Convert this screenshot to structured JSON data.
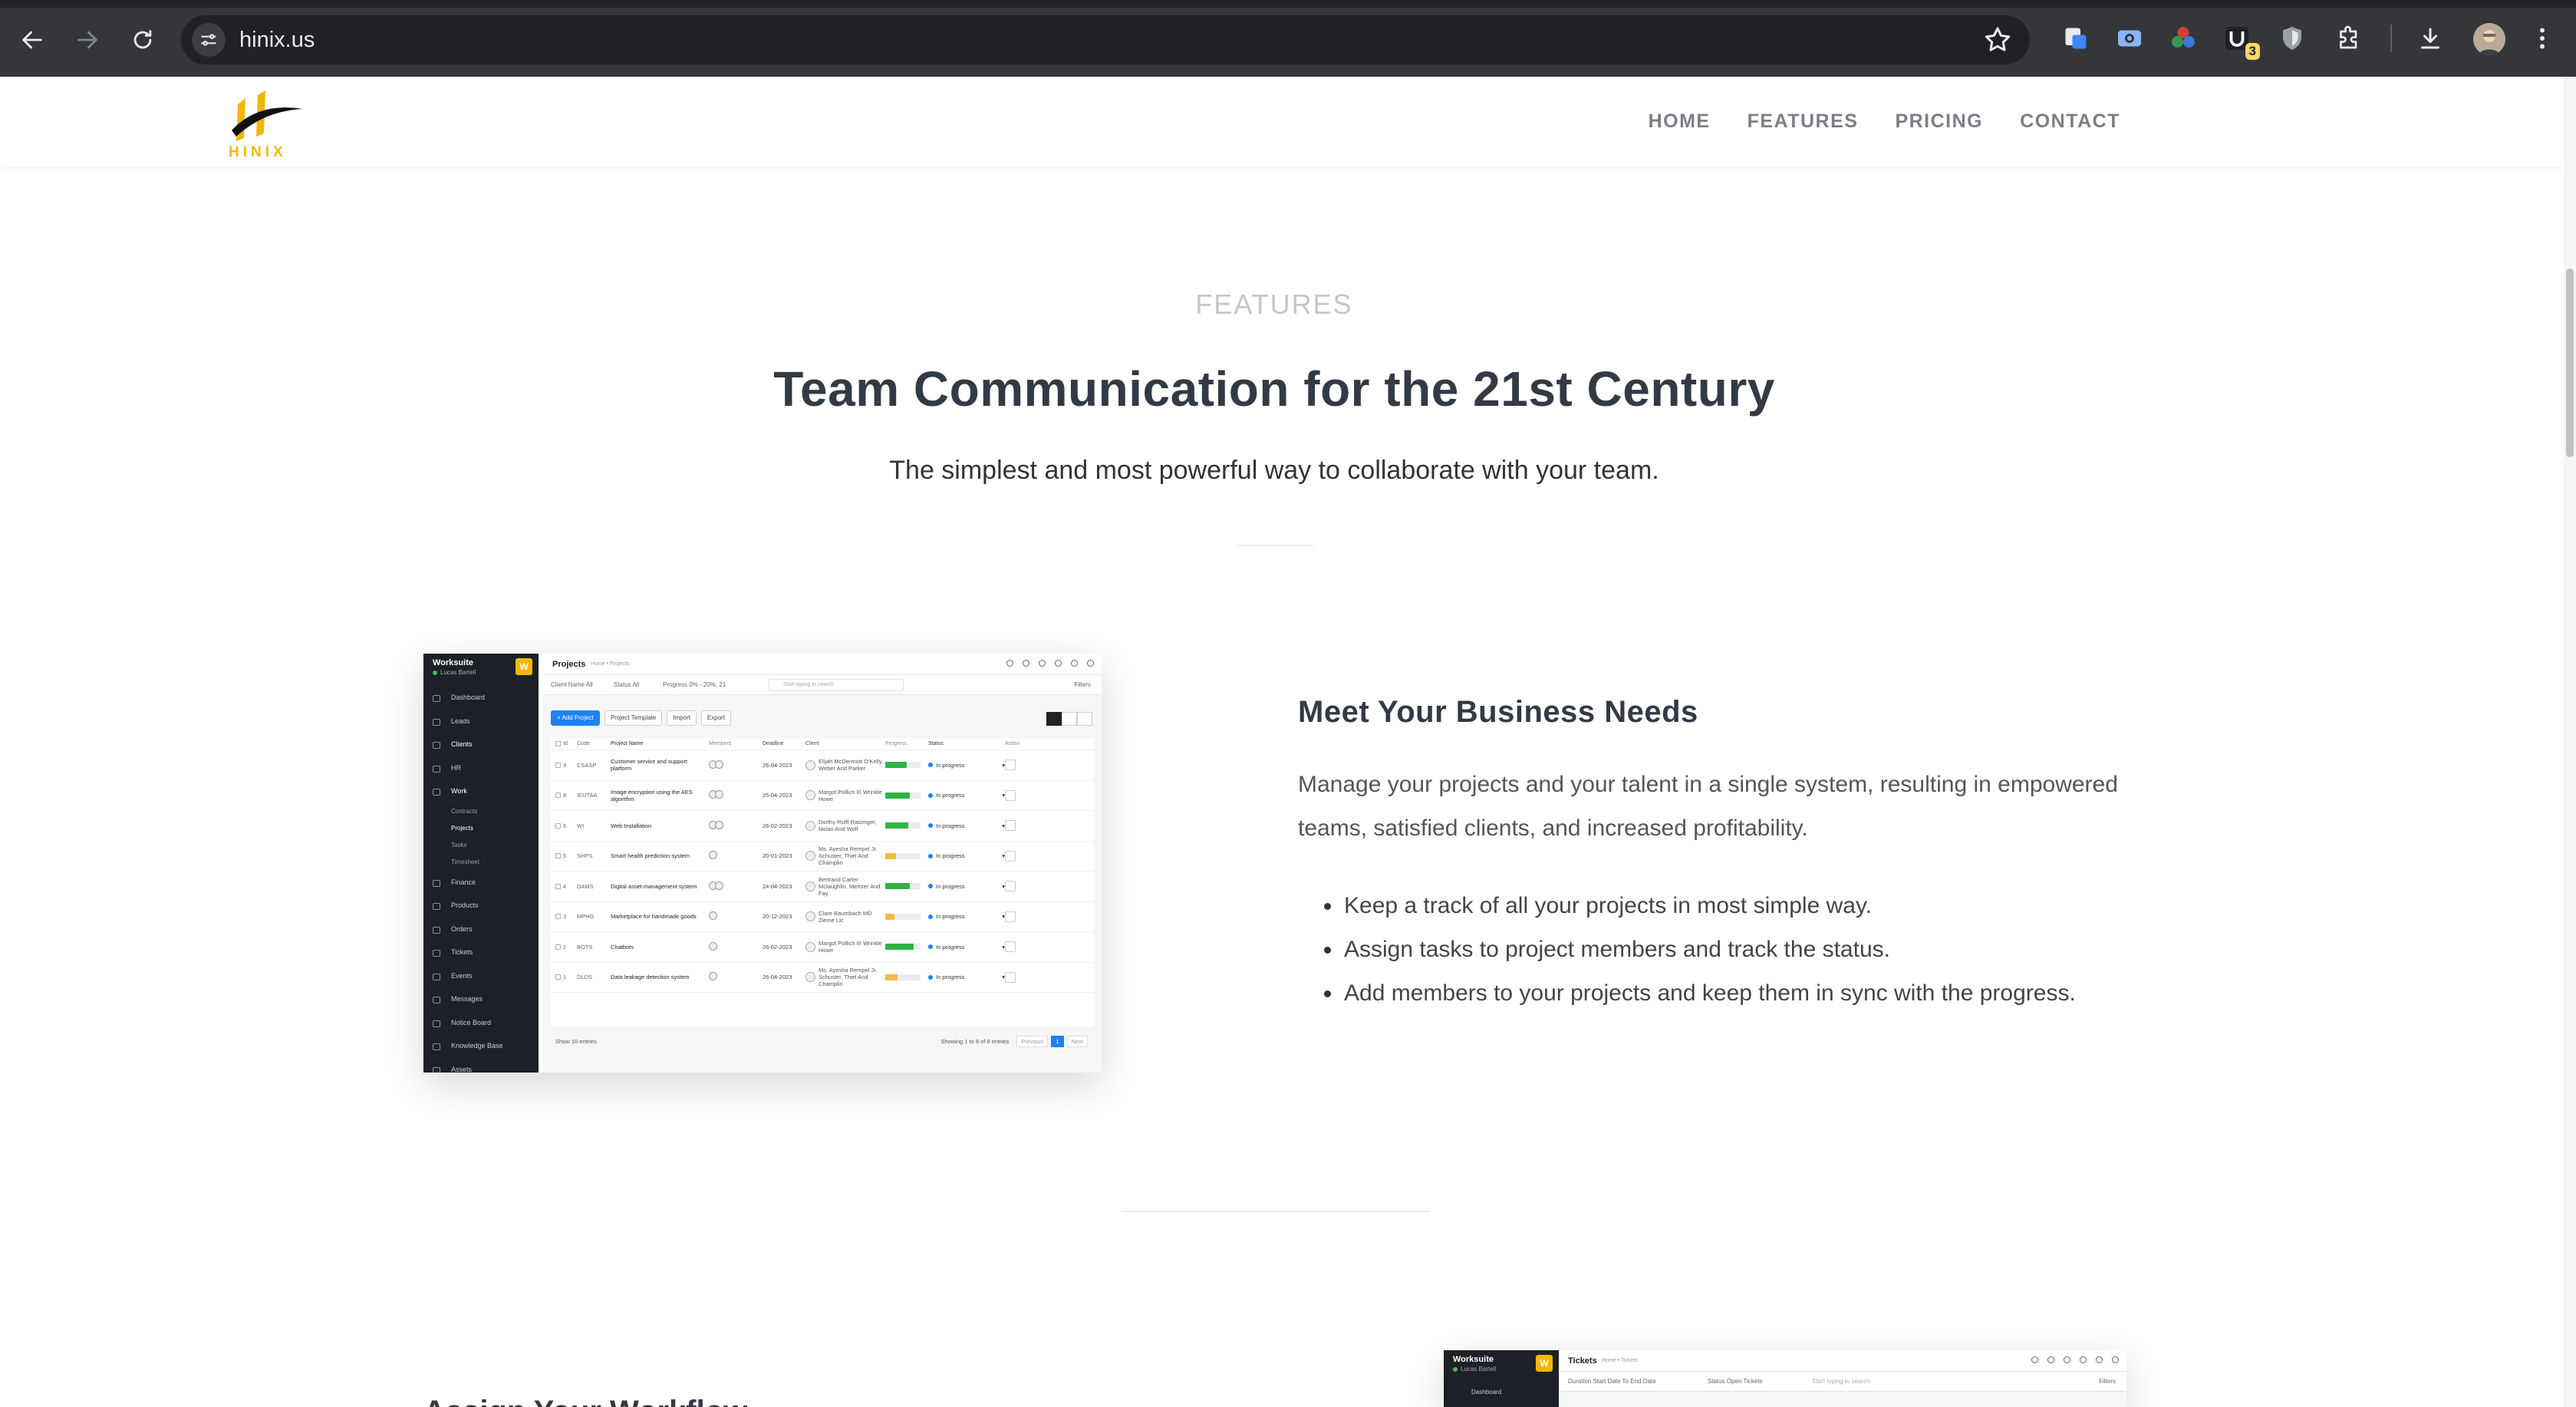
{
  "browser": {
    "url": "hinix.us",
    "extension_badge": "3"
  },
  "site": {
    "logo_text": "HINIX",
    "nav": [
      "HOME",
      "FEATURES",
      "PRICING",
      "CONTACT"
    ]
  },
  "features_section": {
    "label": "FEATURES",
    "title": "Team Communication for the 21st Century",
    "subtitle": "The simplest and most powerful way to collaborate with your team."
  },
  "feature1": {
    "title": "Meet Your Business Needs",
    "description": "Manage your projects and your talent in a single system, resulting in empowered teams, satisfied clients, and increased profitability.",
    "bullets": [
      "Keep a track of all your projects in most simple way.",
      "Assign tasks to project members and track the status.",
      "Add members to your projects and keep them in sync with the progress."
    ]
  },
  "feature2": {
    "title_partial": "Assign Your Workflow"
  },
  "colors": {
    "accent_yellow": "#f2b705",
    "heading": "#343a45",
    "nav_text": "#7b7f85",
    "app_primary": "#1d82f5",
    "app_sidebar": "#1d2127"
  },
  "mock_app": {
    "brand": "Worksuite",
    "user": "Lucas Bartell",
    "logo_letter": "W",
    "page_title": "Projects",
    "breadcrumb": "Home • Projects",
    "sidebar": [
      {
        "label": "Dashboard",
        "active": false
      },
      {
        "label": "Leads",
        "active": false
      },
      {
        "label": "Clients",
        "active": true
      },
      {
        "label": "HR",
        "active": false
      },
      {
        "label": "Work",
        "active": true
      }
    ],
    "sidebar_sub": [
      {
        "label": "Contracts",
        "active": false
      },
      {
        "label": "Projects",
        "active": true
      },
      {
        "label": "Tasks",
        "active": false
      },
      {
        "label": "Timesheet",
        "active": false
      }
    ],
    "sidebar_more": [
      "Finance",
      "Products",
      "Orders",
      "Tickets",
      "Events",
      "Messages",
      "Notice Board",
      "Knowledge Base",
      "Assets"
    ],
    "filters": {
      "client": "Client Name  All",
      "status": "Status  All",
      "progress": "Progress  0% - 20%, 21",
      "search_placeholder": "Start typing to search",
      "filters_label": "Filters"
    },
    "actions": [
      "+ Add Project",
      "Project Template",
      "Import",
      "Export"
    ],
    "columns": [
      "Id",
      "Code",
      "Project Name",
      "Members",
      "Deadline",
      "Client",
      "Progress",
      "Status",
      "Action"
    ],
    "rows": [
      {
        "id": "9",
        "code": "CSASP",
        "name": "Customer service and support platform",
        "members": 2,
        "deadline": "26-04-2023",
        "client": "Elijah McDermott O'Kelly, Weber And Parker",
        "progress": 0.6,
        "pcolor": "#2fb344",
        "status": "In progress"
      },
      {
        "id": "8",
        "code": "IEUTAA",
        "name": "Image encryption using the AES algorithm",
        "members": 2,
        "deadline": "25-04-2023",
        "client": "Margot Pollich III Wrinkle Howe",
        "progress": 0.7,
        "pcolor": "#2fb344",
        "status": "In progress"
      },
      {
        "id": "6",
        "code": "WI",
        "name": "Web Installation",
        "members": 2,
        "deadline": "26-02-2023",
        "client": "Dorthy Rolff Ratzinger, Nolan And Wolf",
        "progress": 0.65,
        "pcolor": "#2fb344",
        "status": "In progress"
      },
      {
        "id": "5",
        "code": "SHPS",
        "name": "Smart health prediction system",
        "members": 1,
        "deadline": "20-01-2023",
        "client": "Ms. Ayesha Rempel Jr. Schuster, Thiel And Champlin",
        "progress": 0.3,
        "pcolor": "#f5b946",
        "status": "In progress"
      },
      {
        "id": "4",
        "code": "DAMS",
        "name": "Digital asset management system",
        "members": 2,
        "deadline": "24-04-2023",
        "client": "Bertrand Carter Mclaughlin, Mertzer And Fay",
        "progress": 0.7,
        "pcolor": "#2fb344",
        "status": "In progress"
      },
      {
        "id": "3",
        "code": "MPHG",
        "name": "Marketplace for handmade goods",
        "members": 1,
        "deadline": "20-12-2023",
        "client": "Clare Baumbach MD Zieme Llc",
        "progress": 0.25,
        "pcolor": "#f5b946",
        "status": "In progress"
      },
      {
        "id": "2",
        "code": "BOTS",
        "name": "Chatbots",
        "members": 1,
        "deadline": "26-02-2023",
        "client": "Margot Pollich III Wrinkle Howe",
        "progress": 0.8,
        "pcolor": "#2fb344",
        "status": "In progress"
      },
      {
        "id": "1",
        "code": "DLDS",
        "name": "Data leakage detection system",
        "members": 1,
        "deadline": "26-04-2023",
        "client": "Ms. Ayesha Rempel Jr. Schuster, Thiel And Champlin",
        "progress": 0.35,
        "pcolor": "#f5b946",
        "status": "In progress"
      }
    ],
    "footer": {
      "show": "Show  10  entries",
      "info": "Showing 1 to 8 of 8 entries",
      "pages": [
        "Previous",
        "1",
        "Next"
      ]
    }
  },
  "mock_app2": {
    "brand": "Worksuite",
    "user": "Lucas Bartell",
    "page_title": "Tickets",
    "breadcrumb": "Home • Tickets",
    "sidebar_first": "Dashboard",
    "filters": {
      "duration": "Duration   Start Date To End Date",
      "status": "Status   Open Tickets",
      "search_placeholder": "Start typing to search",
      "filters_label": "Filters"
    }
  }
}
